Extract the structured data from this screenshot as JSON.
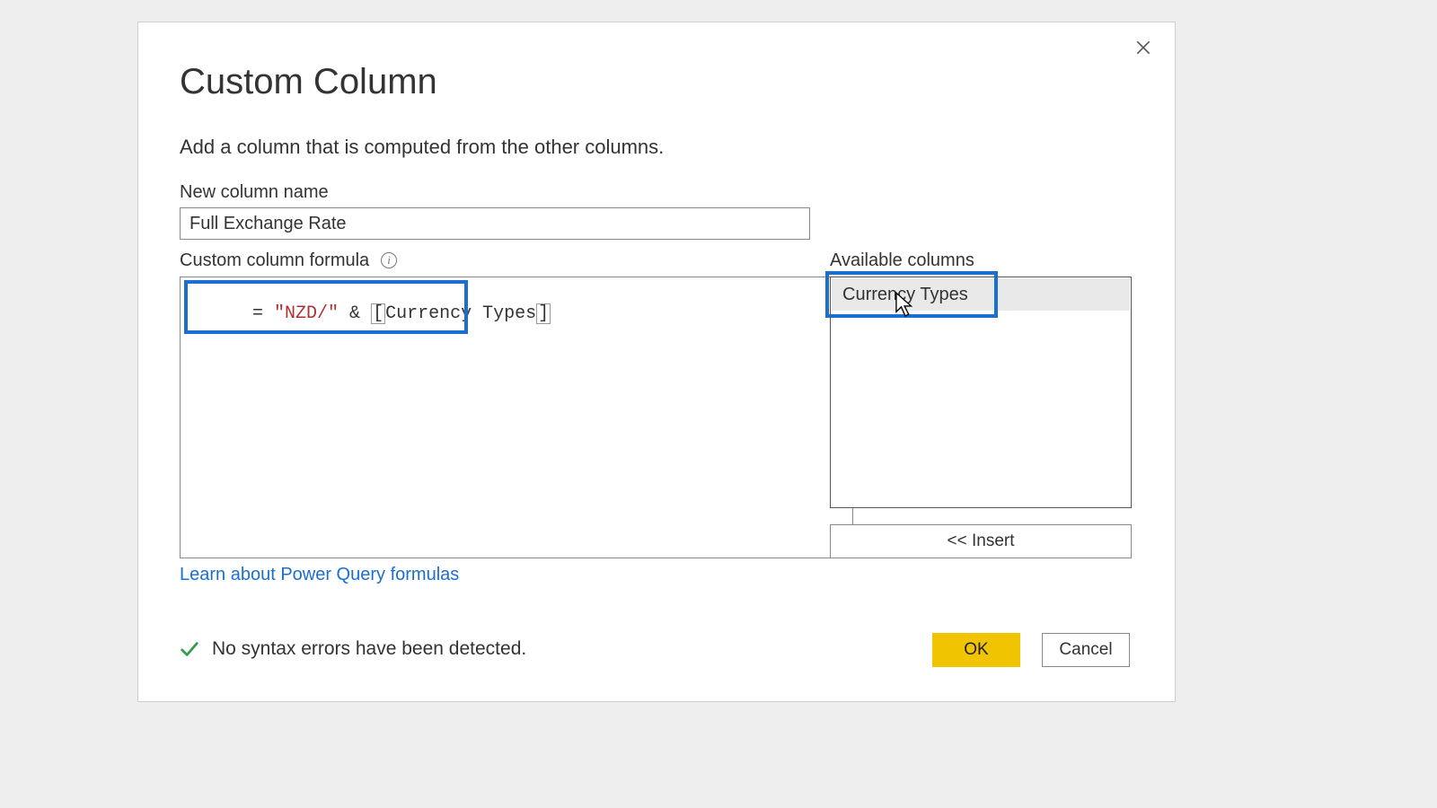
{
  "dialog": {
    "title": "Custom Column",
    "subtitle": "Add a column that is computed from the other columns.",
    "close_label": "Close"
  },
  "new_column": {
    "label": "New column name",
    "value": "Full Exchange Rate"
  },
  "formula": {
    "label": "Custom column formula",
    "info_symbol": "i",
    "tokens": {
      "eq": "= ",
      "str": "\"NZD/\"",
      "amp": " & ",
      "lbr": "[",
      "col": "Currency Types",
      "rbr": "]"
    }
  },
  "available": {
    "label": "Available columns",
    "items": [
      "Currency Types"
    ]
  },
  "buttons": {
    "insert": "<< Insert",
    "ok": "OK",
    "cancel": "Cancel"
  },
  "link": {
    "learn": "Learn about Power Query formulas"
  },
  "status": {
    "message": "No syntax errors have been detected."
  },
  "colors": {
    "highlight": "#1b6fd1",
    "ok_button": "#f0c400",
    "check": "#2e9e4a"
  }
}
